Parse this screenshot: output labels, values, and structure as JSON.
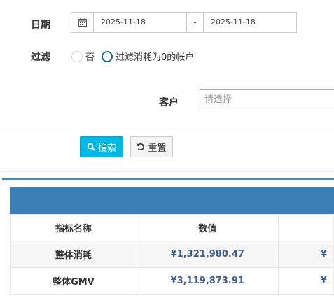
{
  "filters": {
    "date_label": "日期",
    "date_start": "2025-11-18",
    "date_separator": "-",
    "date_end": "2025-11-18",
    "filter_label": "过滤",
    "filter_options": [
      "否",
      "过滤消耗为0的帐户"
    ],
    "filter_selected": "过滤消耗为0的帐户",
    "customer_label": "客户",
    "customer_placeholder": "请选择"
  },
  "actions": {
    "search_label": "搜索",
    "reset_label": "重置"
  },
  "table": {
    "headers": [
      "指标名称",
      "数值",
      ""
    ],
    "rows": [
      {
        "name": "整体消耗",
        "value": "¥1,321,980.47",
        "extra": "¥"
      },
      {
        "name": "整体GMV",
        "value": "¥3,119,873.91",
        "extra": "¥"
      }
    ]
  },
  "colors": {
    "accent": "#00b8e6",
    "panel_header": "#3a7fb5",
    "value_text": "#3f5e8f"
  }
}
